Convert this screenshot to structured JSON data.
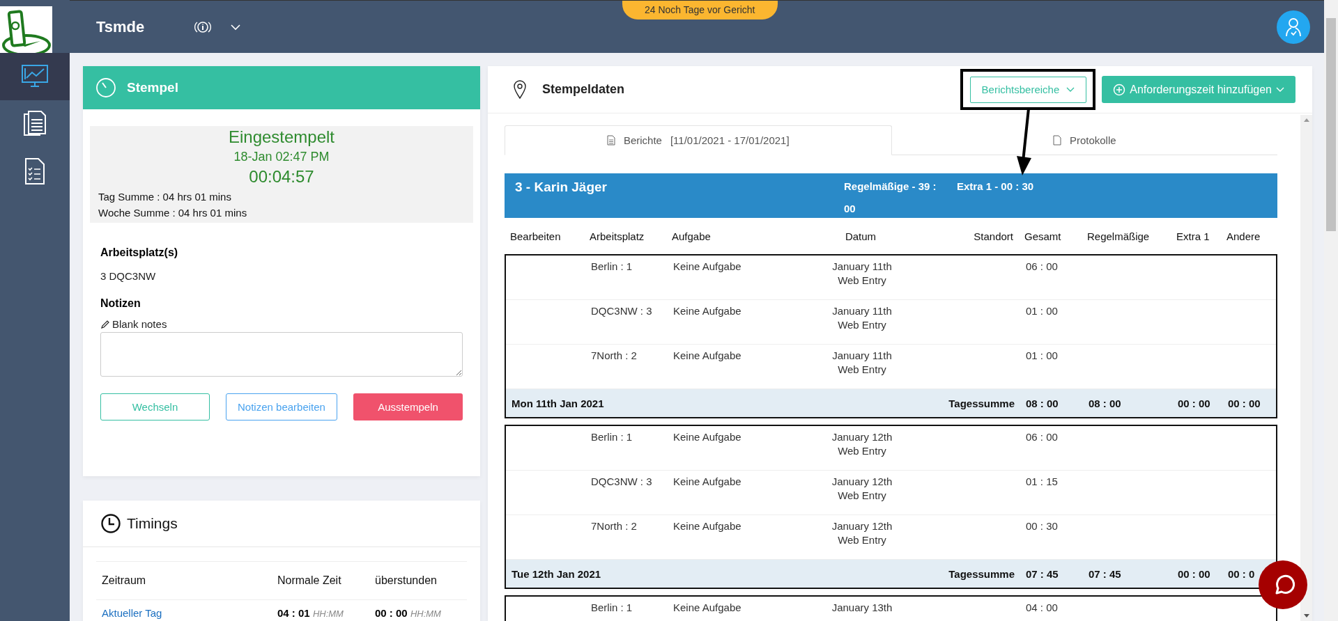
{
  "app": {
    "name": "Tsmde",
    "banner": "24 Noch Tage vor Gericht"
  },
  "sidebar": {
    "items": [
      {
        "kind": "chart",
        "selected": true
      },
      {
        "kind": "documents",
        "selected": false
      },
      {
        "kind": "checklist",
        "selected": false
      }
    ]
  },
  "stempel": {
    "title": "Stempel",
    "status": "Eingestempelt",
    "date": "18-Jan 02:47 PM",
    "timer": "00:04:57",
    "day_total": "Tag Summe : 04 hrs 01 mins",
    "week_total": "Woche Summe : 04 hrs 01 mins",
    "workplace_label": "Arbeitsplatz(s)",
    "workplace": "3 DQC3NW",
    "notes_label": "Notizen",
    "notes_hint": "Blank notes",
    "buttons": [
      {
        "label": "Wechseln",
        "kind": "switch"
      },
      {
        "label": "Notizen bearbeiten",
        "kind": "notes"
      },
      {
        "label": "Ausstempeln",
        "kind": "clock-out"
      }
    ]
  },
  "timings": {
    "title": "Timings",
    "columns": [
      "Zeitraum",
      "Normale Zeit",
      "überstunden"
    ],
    "rows": [
      {
        "period": "Aktueller Tag",
        "normal": "04 : 01",
        "normal_unit": "HH:MM",
        "overtime": "00 : 00",
        "overtime_unit": "HH:MM"
      }
    ]
  },
  "stempeldaten": {
    "title": "Stempeldaten",
    "range_button": {
      "label": "Berichtsbereiche",
      "highlighted": true
    },
    "add_button": "Anforderungszeit hinzufügen",
    "tabs": [
      {
        "label": "Berichte",
        "range": "[11/01/2021 - 17/01/2021]",
        "selected": true
      },
      {
        "label": "Protokolle",
        "selected": false
      }
    ],
    "employee": {
      "name": "3 - Karin Jäger",
      "regular": "Regelmäßige - 39 : 00",
      "extra": "Extra 1 - 00 : 30"
    },
    "columns": [
      "Bearbeiten",
      "Arbeitsplatz",
      "Aufgabe",
      "Datum",
      "Standort",
      "Gesamt",
      "Regelmäßige",
      "Extra 1",
      "Andere"
    ],
    "days": [
      {
        "entries": [
          {
            "workplace": "Berlin : 1",
            "task": "Keine Aufgabe",
            "date": "January 11th",
            "source": "Web Entry",
            "total": "06 : 00"
          },
          {
            "workplace": "DQC3NW : 3",
            "task": "Keine Aufgabe",
            "date": "January 11th",
            "source": "Web Entry",
            "total": "01 : 00"
          },
          {
            "workplace": "7North : 2",
            "task": "Keine Aufgabe",
            "date": "January 11th",
            "source": "Web Entry",
            "total": "01 : 00"
          }
        ],
        "summary": {
          "date": "Mon 11th Jan 2021",
          "label": "Tagessumme",
          "total": "08 : 00",
          "regular": "08 : 00",
          "extra": "00 : 00",
          "other": "00 : 00"
        }
      },
      {
        "entries": [
          {
            "workplace": "Berlin : 1",
            "task": "Keine Aufgabe",
            "date": "January 12th",
            "source": "Web Entry",
            "total": "06 : 00"
          },
          {
            "workplace": "DQC3NW : 3",
            "task": "Keine Aufgabe",
            "date": "January 12th",
            "source": "Web Entry",
            "total": "01 : 15"
          },
          {
            "workplace": "7North : 2",
            "task": "Keine Aufgabe",
            "date": "January 12th",
            "source": "Web Entry",
            "total": "00 : 30"
          }
        ],
        "summary": {
          "date": "Tue 12th Jan 2021",
          "label": "Tagessumme",
          "total": "07 : 45",
          "regular": "07 : 45",
          "extra": "00 : 00",
          "other": "00 : 0"
        }
      },
      {
        "entries": [
          {
            "workplace": "Berlin : 1",
            "task": "Keine Aufgabe",
            "date": "January 13th",
            "total": "04 : 00"
          }
        ]
      }
    ]
  }
}
